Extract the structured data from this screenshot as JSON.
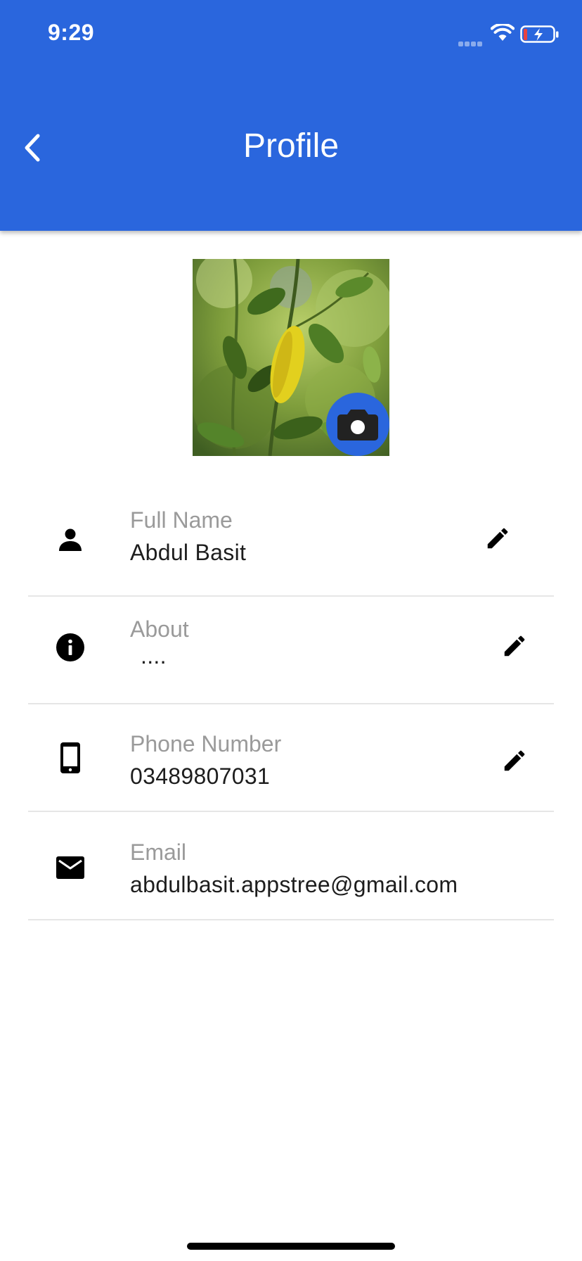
{
  "status_bar": {
    "time": "9:29"
  },
  "header": {
    "title": "Profile"
  },
  "fields": [
    {
      "label": "Full Name",
      "value": "Abdul Basit"
    },
    {
      "label": "About",
      "value": "...."
    },
    {
      "label": "Phone Number",
      "value": "03489807031"
    },
    {
      "label": "Email",
      "value": "abdulbasit.appstree@gmail.com"
    }
  ],
  "icons": {
    "back": "chevron-left-icon",
    "camera": "camera-icon",
    "person": "person-icon",
    "about": "info-icon",
    "phone": "smartphone-icon",
    "email": "mail-icon",
    "edit": "pencil-icon"
  },
  "colors": {
    "primary": "#2A66DD",
    "label": "#9a9a9a",
    "value": "#1d1d1d",
    "divider": "#e6e6e6"
  }
}
